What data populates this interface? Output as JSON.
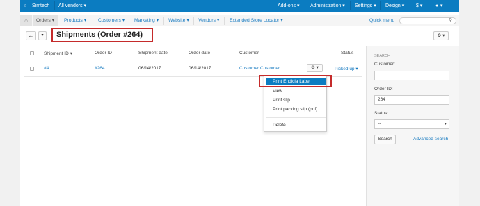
{
  "topbar": {
    "brand": "Simtech",
    "vendor_select": "All vendors ▾",
    "addons": "Add-ons ▾",
    "administration": "Administration ▾",
    "settings": "Settings ▾",
    "design": "Design ▾",
    "currency": "$ ▾",
    "user": "▾"
  },
  "menu": {
    "orders": "Orders ▾",
    "products": "Products ▾",
    "customers": "Customers ▾",
    "marketing": "Marketing ▾",
    "website": "Website ▾",
    "vendors": "Vendors ▾",
    "store_locator": "Extended Store Locator ▾",
    "quick_menu": "Quick menu"
  },
  "header": {
    "back_label": "←",
    "dropdown_label": "▾",
    "title": "Shipments (Order #264)",
    "gear_label": "⚙ ▾"
  },
  "table": {
    "columns": [
      "Shipment ID ▾",
      "Order ID",
      "Shipment date",
      "Order date",
      "Customer",
      "Status"
    ],
    "rows": [
      {
        "shipment_id": "#4",
        "order_id": "#264",
        "shipment_date": "06/14/2017",
        "order_date": "06/14/2017",
        "customer": "Customer Customer",
        "status": "Picked up ▾"
      }
    ],
    "row_gear": "⚙ ▾"
  },
  "dropdown": {
    "items": [
      "Print Endicia Label",
      "View",
      "Print slip",
      "Print packing slip (pdf)",
      "Delete"
    ]
  },
  "sidebar": {
    "heading": "SEARCH",
    "customer_label": "Customer:",
    "customer_value": "",
    "order_id_label": "Order ID:",
    "order_id_value": "264",
    "status_label": "Status:",
    "status_value": "--",
    "search_button": "Search",
    "advanced_search": "Advanced search"
  },
  "colors": {
    "topbar": "#0b7cc1",
    "link": "#1a7cc1",
    "highlight_border": "#c52b2b"
  }
}
